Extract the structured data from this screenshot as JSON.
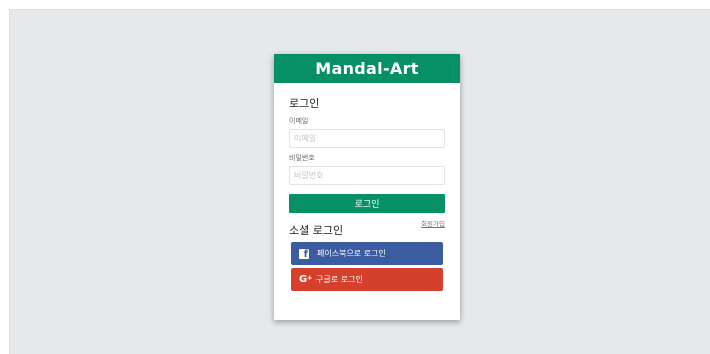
{
  "brand": "Mandal-Art",
  "login": {
    "title": "로그인",
    "email_label": "이메일",
    "email_placeholder": "이메일",
    "password_label": "비밀번호",
    "password_placeholder": "비밀번호",
    "submit_label": "로그인",
    "signup_link": "회원가입"
  },
  "social": {
    "title": "소셜 로그인",
    "facebook_label": "페이스북으로 로그인",
    "google_label": "구글로 로그인",
    "facebook_color": "#3b5da0",
    "google_color": "#d4402b"
  },
  "colors": {
    "accent": "#079066",
    "background": "#e6e9ec"
  }
}
